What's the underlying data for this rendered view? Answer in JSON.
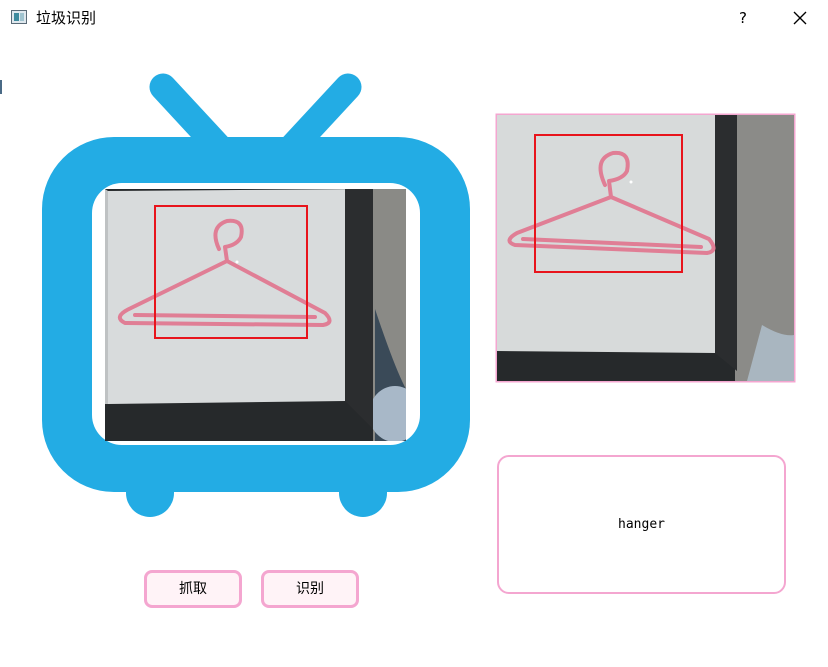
{
  "window": {
    "title": "垃圾识别",
    "help_label": "?",
    "close_icon": "close-icon"
  },
  "camera": {
    "subject": "hanger",
    "detection_box_color": "#e8141c"
  },
  "result": {
    "label": "hanger"
  },
  "buttons": {
    "capture_label": "抓取",
    "recognize_label": "识别"
  },
  "colors": {
    "tv_body": "#23ace4",
    "accent_pink": "#f4a6d0",
    "button_bg": "#fff3f7"
  }
}
